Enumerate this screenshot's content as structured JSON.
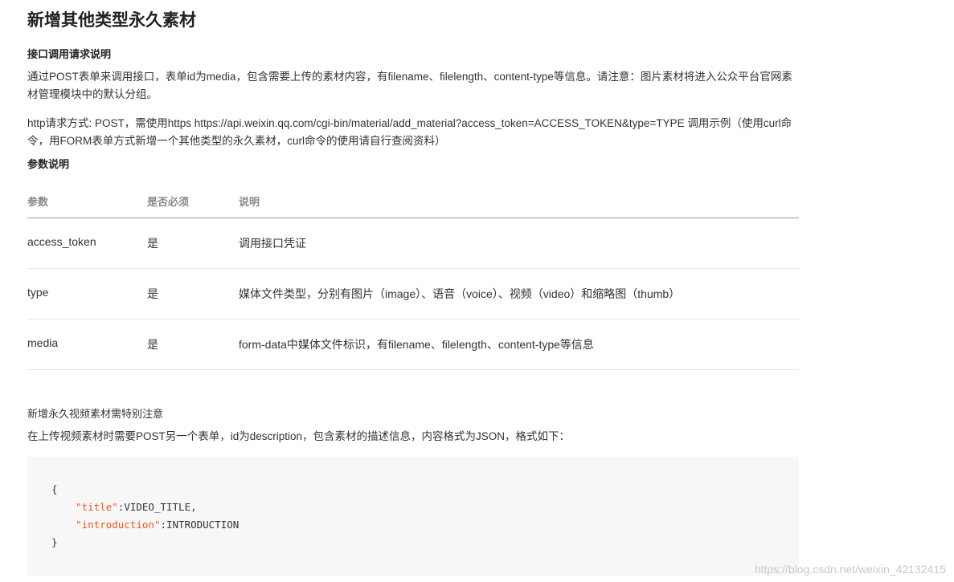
{
  "title": "新增其他类型永久素材",
  "interface": {
    "heading": "接口调用请求说明",
    "description": "通过POST表单来调用接口，表单id为media，包含需要上传的素材内容，有filename、filelength、content-type等信息。请注意：图片素材将进入公众平台官网素材管理模块中的默认分组。",
    "http_method": "http请求方式: POST，需使用https https://api.weixin.qq.com/cgi-bin/material/add_material?access_token=ACCESS_TOKEN&type=TYPE 调用示例（使用curl命令，用FORM表单方式新增一个其他类型的永久素材，curl命令的使用请自行查阅资料）"
  },
  "params": {
    "heading": "参数说明",
    "columns": [
      "参数",
      "是否必须",
      "说明"
    ],
    "rows": [
      {
        "name": "access_token",
        "required": "是",
        "desc": "调用接口凭证"
      },
      {
        "name": "type",
        "required": "是",
        "desc": "媒体文件类型，分别有图片（image）、语音（voice）、视频（video）和缩略图（thumb）"
      },
      {
        "name": "media",
        "required": "是",
        "desc": "form-data中媒体文件标识，有filename、filelength、content-type等信息"
      }
    ]
  },
  "video": {
    "heading": "新增永久视频素材需特别注意",
    "description": "在上传视频素材时需要POST另一个表单，id为description，包含素材的描述信息，内容格式为JSON，格式如下："
  },
  "code": {
    "open": "{",
    "line1_key": "\"title\"",
    "line1_val": ":VIDEO_TITLE,",
    "line2_key": "\"introduction\"",
    "line2_val": ":INTRODUCTION",
    "close": "}"
  },
  "watermark": "https://blog.csdn.net/weixin_42132415"
}
